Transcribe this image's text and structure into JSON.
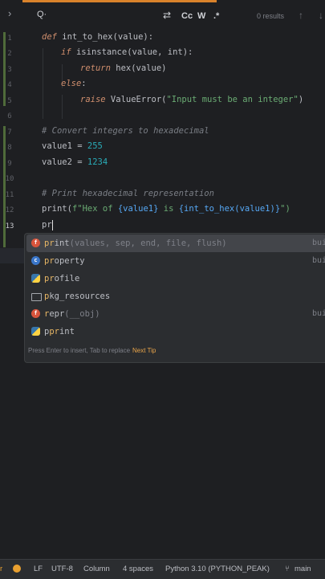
{
  "search": {
    "expand_glyph": "›",
    "search_glyph": "Q·",
    "replace_glyph": "⇄",
    "match_case": "Cc",
    "whole_word": "W",
    "regex": ".*",
    "results": "0 results",
    "up_glyph": "↑",
    "down_glyph": "↓"
  },
  "gutter": [
    "1",
    "2",
    "3",
    "4",
    "5",
    "6",
    "7",
    "8",
    "9",
    "10",
    "11",
    "12",
    "13"
  ],
  "code": {
    "l1": {
      "kw": "def",
      "rest": " int_to_hex(value):"
    },
    "l2": {
      "kw": "if",
      "fn": "isinstance",
      "rest": "(value, int):"
    },
    "l3": {
      "kw": "return",
      "rest": " hex(value)"
    },
    "l4": {
      "kw": "else",
      "rest": ":"
    },
    "l5": {
      "kw": "raise",
      "rest": " ValueError(",
      "str": "\"Input must be an integer\"",
      "end": ")"
    },
    "l7": "# Convert integers to hexadecimal",
    "l8": {
      "name": "value1 = ",
      "num": "255"
    },
    "l9": {
      "name": "value2 = ",
      "num": "1234"
    },
    "l11": "# Print hexadecimal representation",
    "l12": {
      "a": "print(",
      "b": "f\"Hex of ",
      "c": "{value1}",
      "d": " is ",
      "e": "{int_to_hex(value1)}",
      "f": "\")"
    },
    "l13": "pr"
  },
  "completion": {
    "items": [
      {
        "match": "pr",
        "rest": "int",
        "sig": "(values, sep, end, file, flush)",
        "type": "bui",
        "icon": "function-icon"
      },
      {
        "match": "pr",
        "rest": "operty",
        "sig": "",
        "type": "bui",
        "icon": "class-icon"
      },
      {
        "match": "pr",
        "rest": "ofile",
        "sig": "",
        "type": "",
        "icon": "python-module-icon"
      },
      {
        "match": "p",
        "rest": "kg_resources",
        "sig": "",
        "type": "",
        "icon": "folder-icon"
      },
      {
        "match": "r",
        "pre": "",
        "rest": "epr",
        "sig": "(__obj)",
        "type": "bui",
        "icon": "function-icon"
      },
      {
        "match": "pr",
        "pre": "p",
        "rest": "int",
        "sig": "",
        "type": "",
        "icon": "python-module-icon"
      }
    ],
    "hint": "Press Enter to insert, Tab to replace",
    "next_tip": "Next Tip"
  },
  "status": {
    "left_letter": "r",
    "line_sep": "LF",
    "encoding": "UTF-8",
    "column": "Column",
    "indent": "4 spaces",
    "interpreter": "Python 3.10 (PYTHON_PEAK)",
    "branch": "main",
    "branch_glyph": "⑂"
  },
  "colors": {
    "accent": "#d9822b",
    "background": "#1e1f22",
    "keyword": "#cf8e6d",
    "string": "#6aab73",
    "number": "#2aacb8"
  }
}
